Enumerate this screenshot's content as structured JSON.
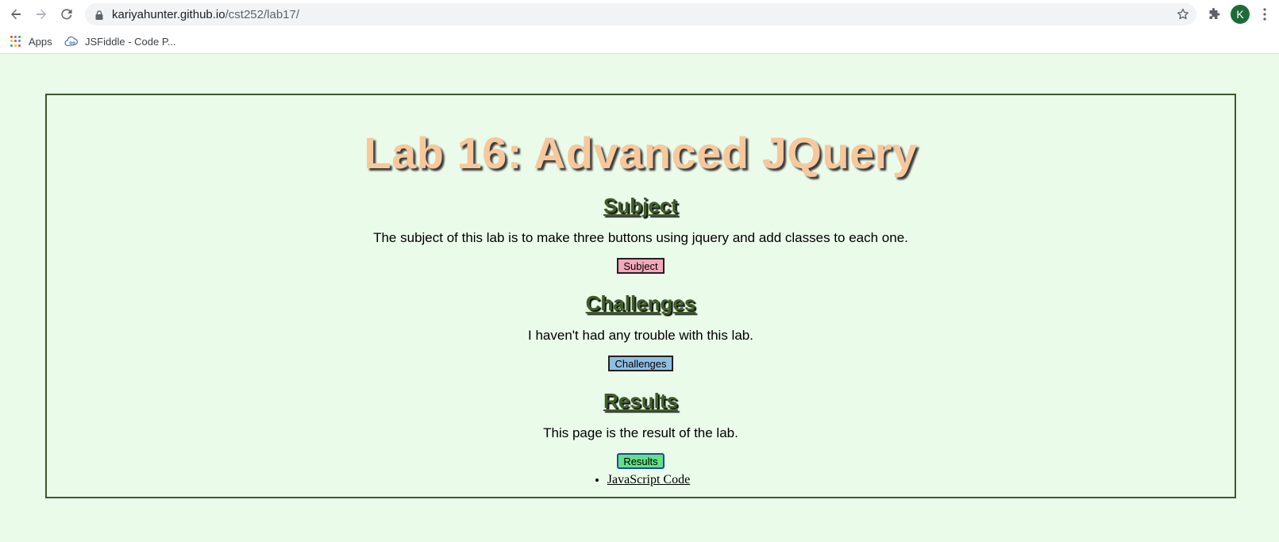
{
  "browser": {
    "url_domain": "kariyahunter.github.io",
    "url_path": "/cst252/lab17/",
    "profile_initial": "K",
    "bookmarks": [
      {
        "label": "Apps"
      },
      {
        "label": "JSFiddle - Code P..."
      }
    ],
    "icons": {
      "back": "back-arrow-icon",
      "forward": "forward-arrow-icon",
      "reload": "reload-icon",
      "lock": "lock-icon",
      "star": "star-icon",
      "extensions": "puzzle-icon",
      "menu": "kebab-menu-icon"
    }
  },
  "page": {
    "title": "Lab 16: Advanced JQuery",
    "sections": [
      {
        "heading": "Subject",
        "text": "The subject of this lab is to make three buttons using jquery and add classes to each one.",
        "button": "Subject"
      },
      {
        "heading": "Challenges",
        "text": "I haven't had any trouble with this lab.",
        "button": "Challenges"
      },
      {
        "heading": "Results",
        "text": "This page is the result of the lab.",
        "button": "Results"
      }
    ],
    "links": [
      {
        "label": "JavaScript Code"
      }
    ]
  },
  "colors": {
    "page_background": "#ebfbea",
    "frame_border": "#3d5a2a",
    "title": "#f6c89c",
    "heading": "#3f5f27",
    "subject_button": "#f4a8bb",
    "challenges_button": "#8fbfe0",
    "results_button": "#62e085"
  }
}
